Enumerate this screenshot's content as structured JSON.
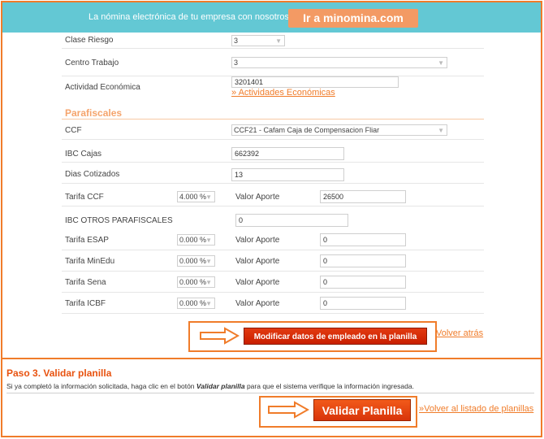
{
  "banner": {
    "text": "La nómina electrónica de tu empresa con nosotros.",
    "button_label": "Ir a minomina.com"
  },
  "form": {
    "clase_riesgo": {
      "label": "Clase Riesgo",
      "value": "3"
    },
    "centro_trabajo": {
      "label": "Centro Trabajo",
      "value": "3"
    },
    "actividad_economica": {
      "label": "Actividad Económica",
      "value": "3201401",
      "link": "» Actividades Económicas"
    },
    "parafiscales_heading": "Parafiscales",
    "ccf": {
      "label": "CCF",
      "value": "CCF21 - Cafam Caja de Compensacion Fliar"
    },
    "ibc_cajas": {
      "label": "IBC Cajas",
      "value": "662392"
    },
    "dias_cotizados": {
      "label": "Dias Cotizados",
      "value": "13"
    },
    "tarifa_ccf": {
      "label": "Tarifa CCF",
      "rate": "4.000 %",
      "aporte_label": "Valor Aporte",
      "aporte_value": "26500"
    },
    "ibc_otros": {
      "label": "IBC OTROS PARAFISCALES",
      "value": "0"
    },
    "tarifa_esap": {
      "label": "Tarifa ESAP",
      "rate": "0.000 %",
      "aporte_label": "Valor Aporte",
      "aporte_value": "0"
    },
    "tarifa_minedu": {
      "label": "Tarifa MinEdu",
      "rate": "0.000 %",
      "aporte_label": "Valor Aporte",
      "aporte_value": "0"
    },
    "tarifa_sena": {
      "label": "Tarifa Sena",
      "rate": "0.000 %",
      "aporte_label": "Valor Aporte",
      "aporte_value": "0"
    },
    "tarifa_icbf": {
      "label": "Tarifa ICBF",
      "rate": "0.000 %",
      "aporte_label": "Valor Aporte",
      "aporte_value": "0"
    }
  },
  "actions": {
    "modify_label": "Modificar datos de empleado en la planilla",
    "back_label": "Volver atrás"
  },
  "step3": {
    "title": "Paso 3. Validar planilla",
    "desc_before": "Si ya completó la información solicitada, haga clic en el botón ",
    "desc_emph": "Validar planilla",
    "desc_after": " para que el sistema verifique la información ingresada.",
    "validate_label": "Validar Planilla",
    "back_list_label": "»Volver al listado de planillas"
  },
  "colors": {
    "accent": "#f07c2a",
    "banner": "#63c8d4",
    "button": "#d8340a"
  }
}
